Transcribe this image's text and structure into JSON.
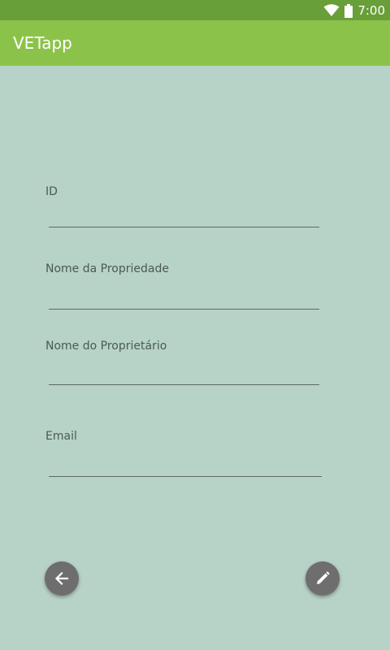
{
  "status_bar": {
    "time": "7:00",
    "icons": [
      "wifi-icon",
      "battery-icon"
    ]
  },
  "app_bar": {
    "title": "VETapp"
  },
  "form": {
    "fields": [
      {
        "label": "ID",
        "value": ""
      },
      {
        "label": "Nome da Propriedade",
        "value": ""
      },
      {
        "label": "Nome do Proprietário",
        "value": ""
      },
      {
        "label": "Email",
        "value": ""
      }
    ]
  },
  "actions": {
    "back_icon": "arrow-left-icon",
    "edit_icon": "pencil-icon"
  },
  "colors": {
    "status_bar": "#689f38",
    "app_bar": "#8bc34a",
    "background": "#b7d2c7",
    "fab": "#6e6e6e"
  }
}
